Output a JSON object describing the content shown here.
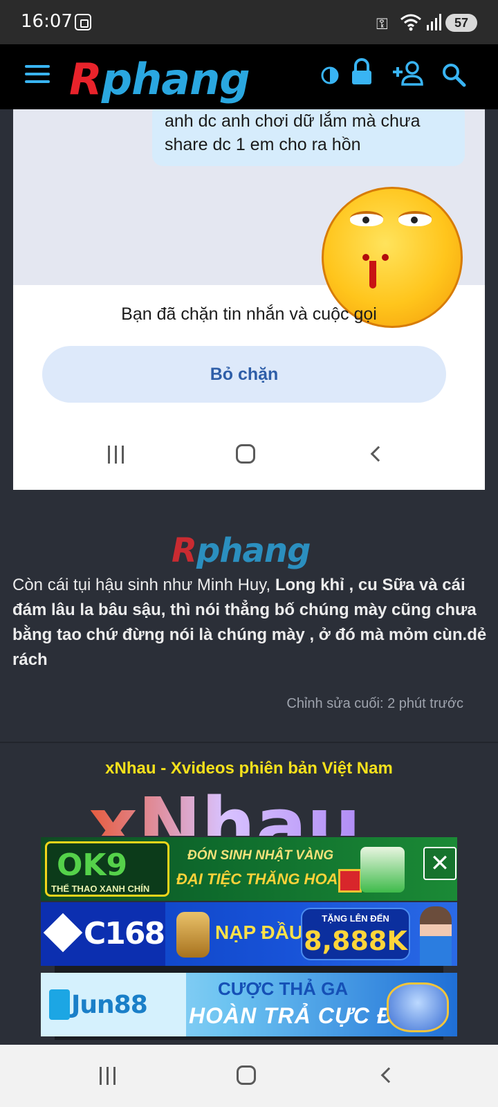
{
  "status_bar": {
    "time": "16:07",
    "battery": "57",
    "icons": [
      "screen-record-icon",
      "vpn-key-icon",
      "wifi-icon",
      "signal-icon",
      "battery-icon"
    ]
  },
  "header": {
    "logo": "Rphang",
    "icons": [
      "menu-icon",
      "contrast-icon",
      "lock-icon",
      "add-user-icon",
      "search-icon"
    ],
    "accent": "#39b4f3"
  },
  "embedded_screenshot": {
    "bubble_text": "anh dc anh chơi dữ lắm mà chưa share dc 1 em cho ra hồn",
    "blocked_text": "Bạn đã chặn tin nhắn và cuộc gọi",
    "unblock_button": "Bỏ chặn"
  },
  "post": {
    "logo": "Rphang",
    "text_part1": "Còn cái tụi hậu sinh như Minh Huy, ",
    "text_bold": "Long khỉ , cu Sữa và cái đám lâu la bâu sậu, thì nói thẳng bố chúng mày cũng chưa bằng tao chứ đừng nói là chúng mày , ở đó mà mỏm cùn.dẻ rách",
    "edited": "Chỉnh sửa cuối: 2 phút trước"
  },
  "ad": {
    "title": "xNhau - Xvideos phiên bản Việt Nam",
    "logo": "xNhau"
  },
  "banners": {
    "ok9": {
      "logo": "OK9",
      "tagline": "THỂ THAO XANH CHÍN",
      "line1": "ĐÓN SINH NHẬT VÀNG",
      "line2": "ĐẠI TIỆC THĂNG HOA"
    },
    "c168": {
      "logo": "C168",
      "line1": "NẠP ĐẦU",
      "box_small": "TẶNG LÊN ĐẾN",
      "box_big": "8,888K"
    },
    "jun88": {
      "logo": "Jun88",
      "line1": "CƯỢC THẢ GA",
      "line2": "HOÀN TRẢ CỰC ĐÃ"
    },
    "close": "✕"
  }
}
